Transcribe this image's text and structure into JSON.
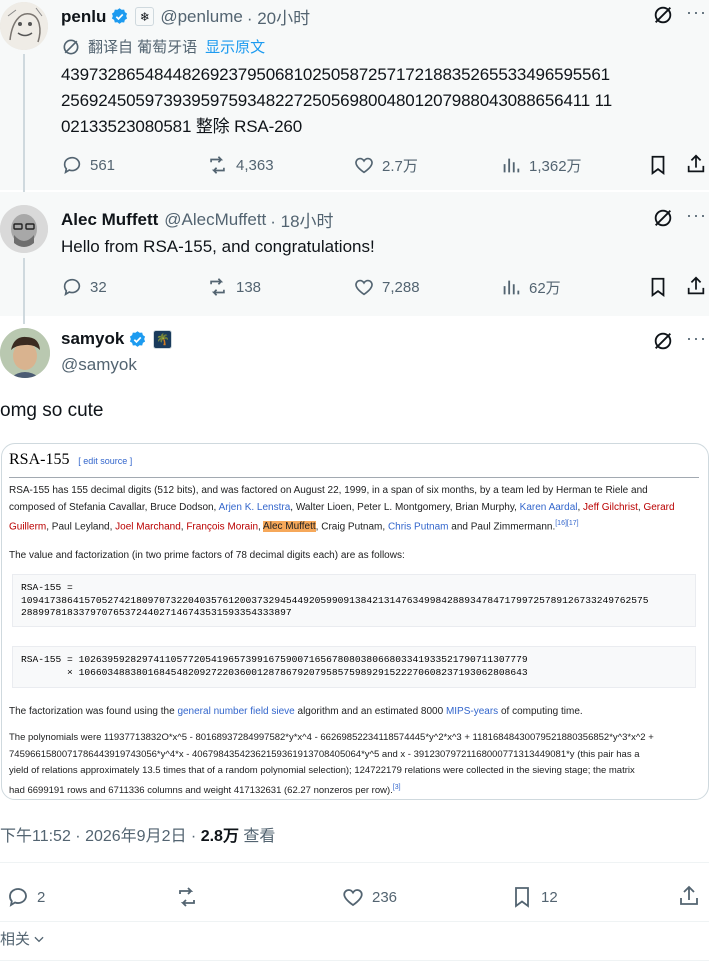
{
  "post1": {
    "name": "penlu",
    "handle": "@penlume",
    "time": "· 20小时",
    "translate_label": "翻译自 葡萄牙语",
    "translate_link": "显示原文",
    "text_lines": [
      "43973286548448269237950681025058725717218835265533496595561",
      "256924505973939597593482272505698004801207988043088656411 11",
      "02133523080581 整除 RSA-260"
    ],
    "replies": "561",
    "reposts": "4,363",
    "likes": "2.7万",
    "views": "1,362万"
  },
  "post2": {
    "name": "Alec Muffett",
    "handle": "@AlecMuffett",
    "time": "· 18小时",
    "text": "Hello from RSA-155, and congratulations!",
    "replies": "32",
    "reposts": "138",
    "likes": "7,288",
    "views": "62万"
  },
  "main": {
    "name": "samyok",
    "handle": "@samyok",
    "text": "omg so cute",
    "timestamp": "下午11:52 · 2026年9月2日 ·",
    "views_count": "2.8万",
    "views_label": "查看",
    "replies": "2",
    "reposts": "",
    "likes": "236",
    "bookmarks": "12",
    "related": "相关"
  },
  "wiki": {
    "title": "RSA-155",
    "edit_label": "[ edit source ]",
    "p1_a": "RSA-155 has 155 decimal digits (512 bits), and was factored on August 22, 1999, in a span of six months, by a team led by Herman te Riele and",
    "p1_b": "composed of Stefania Cavallar, Bruce Dodson, ",
    "p1_lenstra": "Arjen K. Lenstra",
    "p1_c": ", Walter Lioen, Peter L. Montgomery, Brian Murphy, ",
    "p1_aardal": "Karen Aardal",
    "p1_comma1": ", ",
    "p1_gilchrist": "Jeff Gilchrist",
    "p1_comma2": ", ",
    "p1_gerard": "Gerard",
    "p1_guillerm": "Guillerm",
    "p1_d": ", Paul Leyland, ",
    "p1_marchand": "Joel Marchand",
    "p1_comma3": ", ",
    "p1_morain": "François Morain",
    "p1_comma4": ", ",
    "p1_muffett": "Alec Muffett",
    "p1_e": ", Craig Putnam, ",
    "p1_cputnam": "Chris Putnam",
    "p1_f": " and Paul Zimmermann.",
    "p1_ref": "[16][17]",
    "p2": "The value and factorization (in two prime factors of 78 decimal digits each) are as follows:",
    "box1_l1": "RSA-155 =",
    "box1_l2": "1094173864157052742180970732204035761200373294544920599091384213147634998428893478471799725789126733249762575",
    "box1_l3": "28899781833797076537244027146743531593354333897",
    "box2_l1": "RSA-155 = 102639592829741105772054196573991675900716567808038066803341933521790711307779",
    "box2_l2": "        × 106603488380168454820927220360012878679207958575989291522270608237193062808643",
    "p3_a": "The factorization was found using the ",
    "p3_gnfs": "general number field sieve",
    "p3_b": " algorithm and an estimated 8000 ",
    "p3_mips": "MIPS-years",
    "p3_c": " of computing time.",
    "p4_l1": "The polynomials were 11937713832O*x^5 - 80168937284997582*y*x^4 - 66269852234118574445*y^2*x^3 + 11816848430079521880356852*y^3*x^2 +",
    "p4_l2": "7459661580071786443919743056*y^4*x - 40679843542362159361913708405064*y^5 and x - 39123079721168000771313449081*y (this pair has a",
    "p4_l3": "yield of relations approximately 13.5 times that of a random polynomial selection); 124722179 relations were collected in the sieving stage; the matrix",
    "p4_l4": "had 6699191 rows and 6711336 columns and weight 417132631 (62.27 nonzeros per row).",
    "p4_ref": "[3]"
  },
  "colors": {
    "verified": "#1d9bf0",
    "muted": "#536471",
    "link": "#1d9bf0",
    "highlight": "#f6a85a"
  }
}
